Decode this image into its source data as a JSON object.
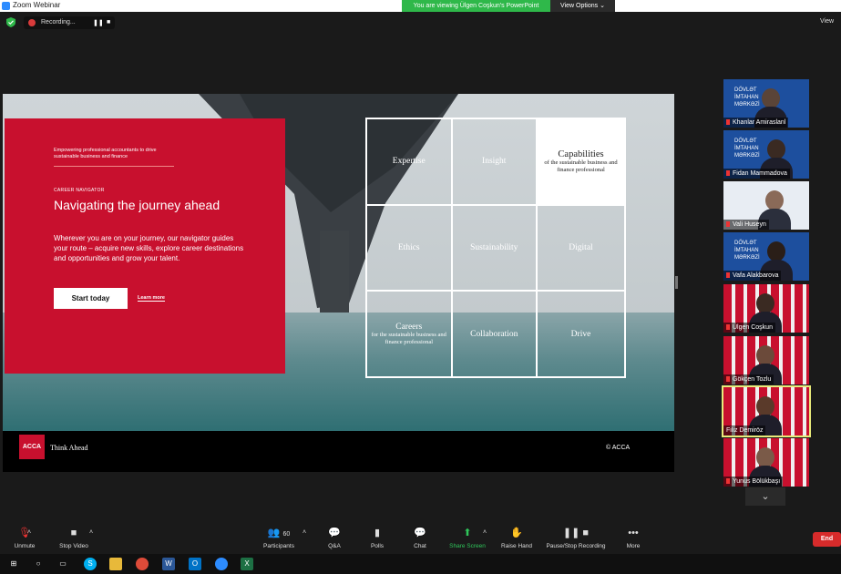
{
  "window": {
    "title": "Zoom Webinar"
  },
  "banner": {
    "viewing": "You are viewing Ülgen Coşkun's PowerPoint",
    "view_options": "View Options ⌄"
  },
  "recording": {
    "label": "Recording...",
    "pause": "❚❚",
    "stop": "■"
  },
  "view_label": "View",
  "slide": {
    "tagline": "Empowering professional accountants to drive sustainable business and finance",
    "section": "CAREER NAVIGATOR",
    "heading": "Navigating the journey ahead",
    "body": "Wherever you are on your journey, our navigator guides your route – acquire new skills, explore career destinations and opportunities and grow your talent.",
    "cta": "Start today",
    "learn_more": "Learn more",
    "grid": [
      {
        "title": "Expertise",
        "sub": ""
      },
      {
        "title": "Insight",
        "sub": ""
      },
      {
        "title": "Capabilities",
        "sub": "of the sustainable business and finance professional"
      },
      {
        "title": "Ethics",
        "sub": ""
      },
      {
        "title": "Sustainability",
        "sub": ""
      },
      {
        "title": "Digital",
        "sub": ""
      },
      {
        "title": "Careers",
        "sub": "for the sustainable business and finance professional"
      },
      {
        "title": "Collaboration",
        "sub": ""
      },
      {
        "title": "Drive",
        "sub": ""
      }
    ],
    "logo": "ACCA",
    "slogan": "Think Ahead",
    "copyright": "© ACCA"
  },
  "participants": [
    {
      "name": "Khanlar Amiraslanl",
      "bg": "dim"
    },
    {
      "name": "Fidan Mammadova",
      "bg": "dim"
    },
    {
      "name": "Vali Huseyn",
      "bg": "dim"
    },
    {
      "name": "Vafa Alakbarova",
      "bg": "dim"
    },
    {
      "name": "Ülgen Coşkun",
      "bg": "acca"
    },
    {
      "name": "Gökçen Tozlu",
      "bg": "acca"
    },
    {
      "name": "Filiz Demiröz",
      "bg": "acca"
    },
    {
      "name": "Yunus Bölükbaşı",
      "bg": "acca"
    }
  ],
  "dim_text": "DÖVLƏT\nİMTAHAN\nMƏRKƏZİ",
  "toolbar": {
    "unmute": "Unmute",
    "stop_video": "Stop Video",
    "participants": "Participants",
    "participant_count": "60",
    "qa": "Q&A",
    "polls": "Polls",
    "chat": "Chat",
    "share_screen": "Share Screen",
    "raise_hand": "Raise Hand",
    "pause_recording": "Pause/Stop Recording",
    "more": "More",
    "end": "End"
  },
  "colors": {
    "acca_red": "#c8102e",
    "zoom_green": "#2fb84a",
    "end_red": "#d72b2b"
  }
}
